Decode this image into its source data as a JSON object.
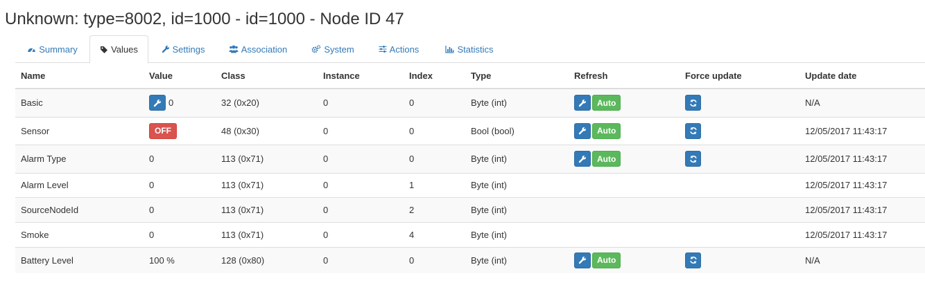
{
  "page": {
    "title": "Unknown: type=8002, id=1000 - id=1000 - Node ID 47"
  },
  "tabs": [
    {
      "label": "Summary",
      "icon": "dashboard-icon",
      "active": false
    },
    {
      "label": "Values",
      "icon": "tag-icon",
      "active": true
    },
    {
      "label": "Settings",
      "icon": "wrench-icon",
      "active": false
    },
    {
      "label": "Association",
      "icon": "users-icon",
      "active": false
    },
    {
      "label": "System",
      "icon": "gears-icon",
      "active": false
    },
    {
      "label": "Actions",
      "icon": "sliders-icon",
      "active": false
    },
    {
      "label": "Statistics",
      "icon": "bar-chart-icon",
      "active": false
    }
  ],
  "table": {
    "headers": {
      "name": "Name",
      "value": "Value",
      "class": "Class",
      "instance": "Instance",
      "index": "Index",
      "type": "Type",
      "refresh": "Refresh",
      "force_update": "Force update",
      "update_date": "Update date"
    },
    "auto_label": "Auto",
    "rows": [
      {
        "name": "Basic",
        "value": "0",
        "value_kind": "editable",
        "class": "32 (0x20)",
        "instance": "0",
        "index": "0",
        "type": "Byte (int)",
        "has_refresh": true,
        "has_force": true,
        "update_date": "N/A"
      },
      {
        "name": "Sensor",
        "value": "OFF",
        "value_kind": "badge-off",
        "class": "48 (0x30)",
        "instance": "0",
        "index": "0",
        "type": "Bool (bool)",
        "has_refresh": true,
        "has_force": true,
        "update_date": "12/05/2017 11:43:17"
      },
      {
        "name": "Alarm Type",
        "value": "0",
        "value_kind": "text",
        "class": "113 (0x71)",
        "instance": "0",
        "index": "0",
        "type": "Byte (int)",
        "has_refresh": true,
        "has_force": true,
        "update_date": "12/05/2017 11:43:17"
      },
      {
        "name": "Alarm Level",
        "value": "0",
        "value_kind": "text",
        "class": "113 (0x71)",
        "instance": "0",
        "index": "1",
        "type": "Byte (int)",
        "has_refresh": false,
        "has_force": false,
        "update_date": "12/05/2017 11:43:17"
      },
      {
        "name": "SourceNodeId",
        "value": "0",
        "value_kind": "text",
        "class": "113 (0x71)",
        "instance": "0",
        "index": "2",
        "type": "Byte (int)",
        "has_refresh": false,
        "has_force": false,
        "update_date": "12/05/2017 11:43:17"
      },
      {
        "name": "Smoke",
        "value": "0",
        "value_kind": "text",
        "class": "113 (0x71)",
        "instance": "0",
        "index": "4",
        "type": "Byte (int)",
        "has_refresh": false,
        "has_force": false,
        "update_date": "12/05/2017 11:43:17"
      },
      {
        "name": "Battery Level",
        "value": "100 %",
        "value_kind": "text",
        "class": "128 (0x80)",
        "instance": "0",
        "index": "0",
        "type": "Byte (int)",
        "has_refresh": true,
        "has_force": true,
        "update_date": "N/A"
      }
    ]
  },
  "colors": {
    "primary": "#337ab7",
    "success": "#5cb85c",
    "danger": "#d9534f",
    "link": "#337ab7",
    "stripe": "#f9f9f9",
    "border": "#dddddd"
  }
}
